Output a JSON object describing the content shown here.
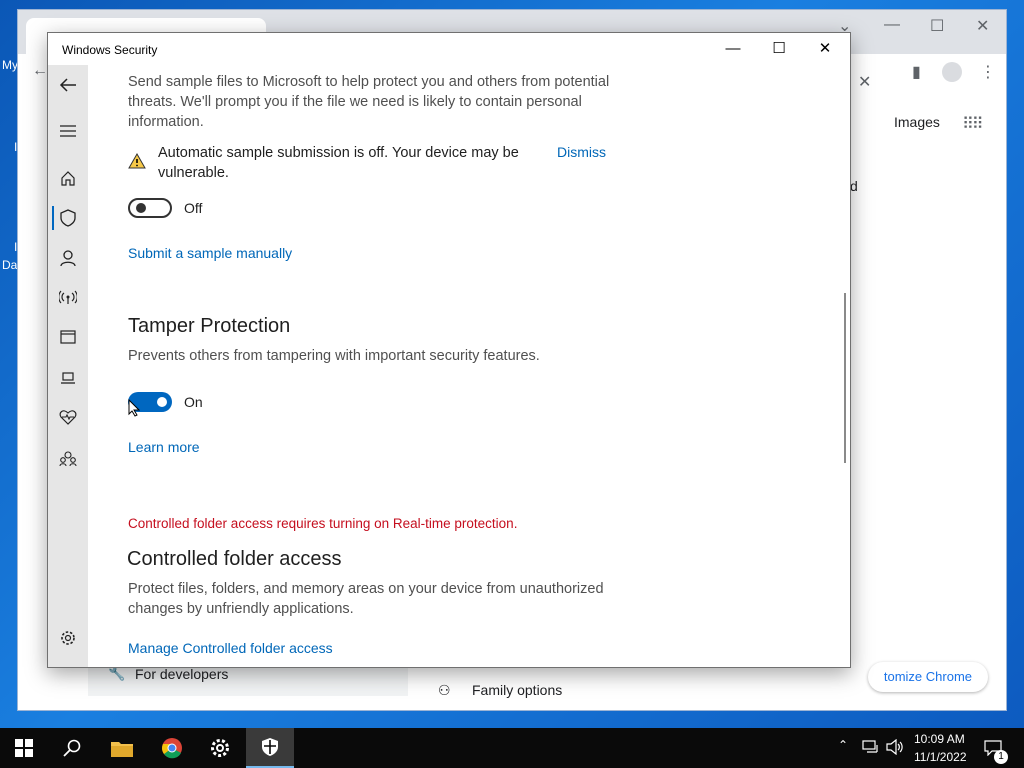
{
  "desktop": {
    "icon_labels": [
      "My",
      "I",
      "I",
      "Da"
    ]
  },
  "chrome": {
    "toolbar": {
      "images_label": "Images"
    },
    "partial_text": "d",
    "customize_label": "tomize Chrome",
    "sidebar_item": "For developers",
    "family_options": "Family options"
  },
  "security_window": {
    "title": "Windows Security",
    "controls": {
      "minimize": "—",
      "maximize": "☐",
      "close": "✕"
    },
    "sample_submission": {
      "description": "Send sample files to Microsoft to help protect you and others from potential threats. We'll prompt you if the file we need is likely to contain personal information.",
      "warning": "Automatic sample submission is off. Your device may be vulnerable.",
      "dismiss": "Dismiss",
      "toggle_state": "Off",
      "manual_link": "Submit a sample manually"
    },
    "tamper": {
      "title": "Tamper Protection",
      "description": "Prevents others from tampering with important security features.",
      "toggle_state": "On",
      "learn_more": "Learn more"
    },
    "controlled_folder": {
      "alert": "Controlled folder access requires turning on Real-time protection.",
      "title": "Controlled folder access",
      "description": "Protect files, folders, and memory areas on your device from unauthorized changes by unfriendly applications.",
      "manage_link": "Manage Controlled folder access"
    },
    "nav_icons": [
      "back-arrow-icon",
      "hamburger-icon",
      "home-icon",
      "shield-icon",
      "account-icon",
      "network-icon",
      "app-browser-icon",
      "device-security-icon",
      "health-icon",
      "family-icon",
      "settings-icon"
    ]
  },
  "colors": {
    "accent": "#0067c0",
    "link": "#0067b8",
    "alert": "#c50f1f"
  },
  "taskbar": {
    "time": "10:09 AM",
    "date": "11/1/2022",
    "notification_count": "1"
  }
}
